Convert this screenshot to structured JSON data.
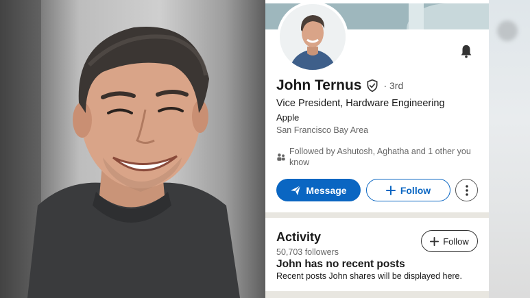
{
  "profile": {
    "name": "John Ternus",
    "degree": "· 3rd",
    "headline": "Vice President, Hardware Engineering",
    "company": "Apple",
    "location": "San Francisco Bay Area",
    "followed_by": "Followed by Ashutosh, Aghatha and 1 other you know"
  },
  "actions": {
    "message_label": "Message",
    "follow_label": "Follow"
  },
  "activity": {
    "title": "Activity",
    "followers": "50,703 followers",
    "follow_label": "Follow",
    "empty_title": "John has no recent posts",
    "empty_sub": "Recent posts John shares will be displayed here."
  },
  "icons": [
    "bell-icon",
    "verified-shield-icon",
    "connections-icon",
    "send-icon",
    "plus-icon",
    "more-vertical-icon"
  ],
  "colors": {
    "accent": "#0a66c2",
    "text": "#191919",
    "muted": "#666666"
  }
}
